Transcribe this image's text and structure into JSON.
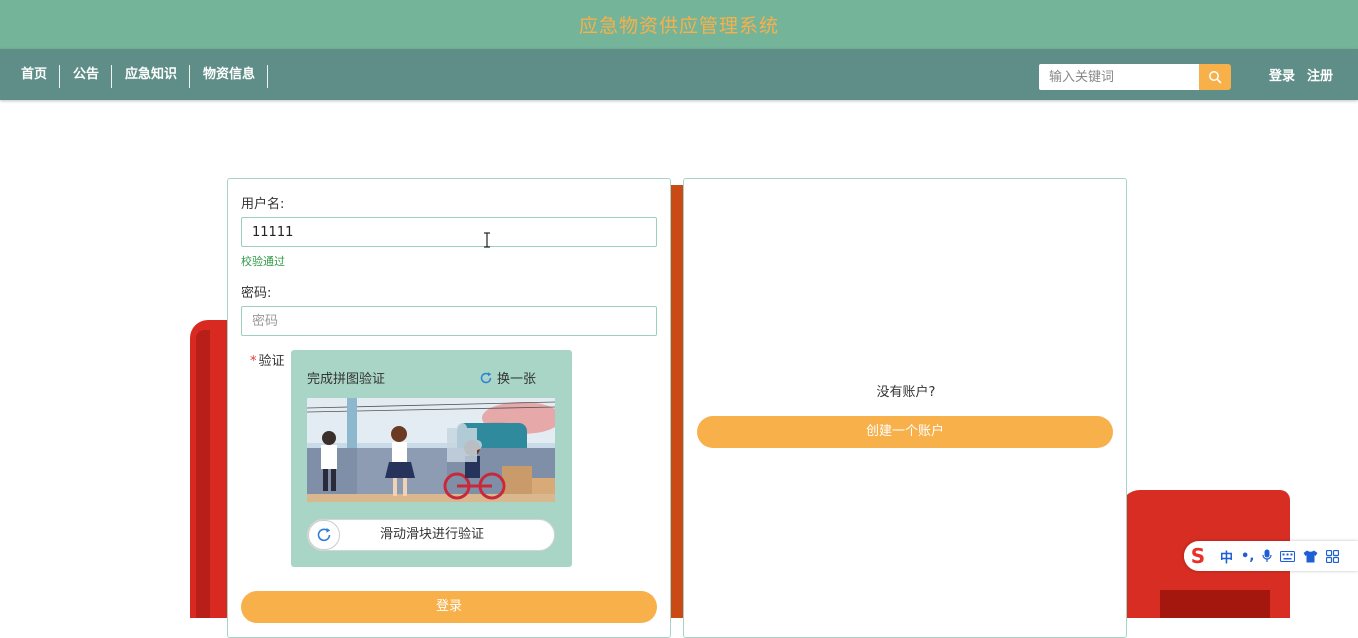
{
  "app": {
    "title": "应急物资供应管理系统"
  },
  "nav": {
    "items": [
      {
        "label": "首页"
      },
      {
        "label": "公告"
      },
      {
        "label": "应急知识"
      },
      {
        "label": "物资信息"
      }
    ]
  },
  "search": {
    "placeholder": "输入关键词",
    "value": "",
    "icon": "search-icon"
  },
  "auth": {
    "login_label": "登录",
    "register_label": "注册"
  },
  "login_form": {
    "username_label": "用户名:",
    "username_value": "11111",
    "username_status": "校验通过",
    "password_label": "密码:",
    "password_placeholder": "密码",
    "password_value": "",
    "captcha_label": "验证",
    "captcha_required_mark": "*",
    "captcha_title": "完成拼图验证",
    "captcha_refresh_label": "换一张",
    "slider_text": "滑动滑块进行验证",
    "submit_label": "登录"
  },
  "register_panel": {
    "no_account_text": "没有账户?",
    "create_account_label": "创建一个账户"
  },
  "ime_toolbar": {
    "logo": "S",
    "mode": "中",
    "punct": "•,",
    "icons": [
      "microphone-icon",
      "keyboard-icon",
      "shirt-icon",
      "grid-icon"
    ]
  },
  "colors": {
    "header_bg": "#74b59a",
    "nav_bg": "#5f8d87",
    "accent": "#f7b04a",
    "success": "#2e9a47",
    "border": "#a6d3c7"
  }
}
